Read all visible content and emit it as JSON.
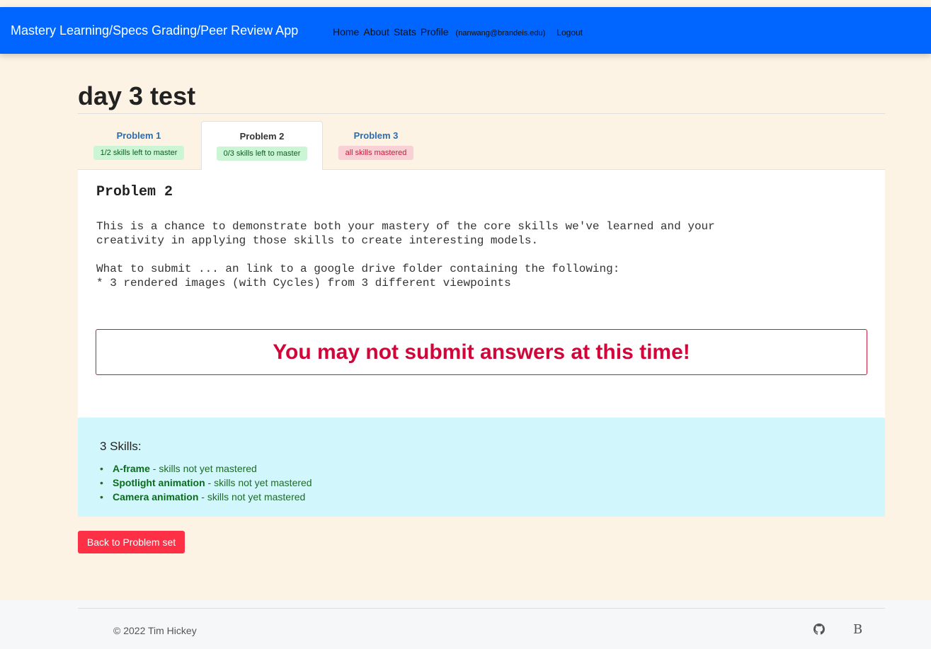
{
  "navbar": {
    "brand": "Mastery Learning/Specs Grading/Peer Review App",
    "home": "Home",
    "about": "About",
    "stats": "Stats",
    "profile": "Profile",
    "email": "(nanwang@brandeis.edu)",
    "logout": "Logout"
  },
  "page": {
    "title": "day 3 test"
  },
  "tabs": [
    {
      "label": "Problem 1",
      "badge": "1/2 skills left to master",
      "badge_color": "green"
    },
    {
      "label": "Problem 2",
      "badge": "0/3 skills left to master",
      "badge_color": "green",
      "active": true
    },
    {
      "label": "Problem 3",
      "badge": "all skills mastered",
      "badge_color": "pink"
    }
  ],
  "problem": {
    "heading": "Problem 2",
    "body": "This is a chance to demonstrate both your mastery of the core skills we've learned and your\ncreativity in applying those skills to create interesting models.\n\nWhat to submit ... an link to a google drive folder containing the following:\n* 3 rendered images (with Cycles) from 3 different viewpoints",
    "alert": "You may not submit answers at this time!"
  },
  "skills": {
    "title": "3 Skills:",
    "status_text": " - skills not yet mastered",
    "items": [
      "A-frame",
      "Spotlight animation",
      "Camera animation"
    ]
  },
  "back_button": "Back to Problem set",
  "footer": {
    "copyright": "© 2022 Tim Hickey",
    "b_icon_text": "B"
  },
  "colors": {
    "navbar": "#0066ff",
    "page_bg": "#fdf3e4",
    "alert_red": "#d1053a",
    "skills_bg": "#d1f6fc",
    "button_red": "#fd3046",
    "badge_green_bg": "#ccf5d6",
    "badge_pink_bg": "#f9d0d6"
  },
  "icons": [
    "github-icon",
    "bootstrap-icon",
    "bullet-icon"
  ]
}
